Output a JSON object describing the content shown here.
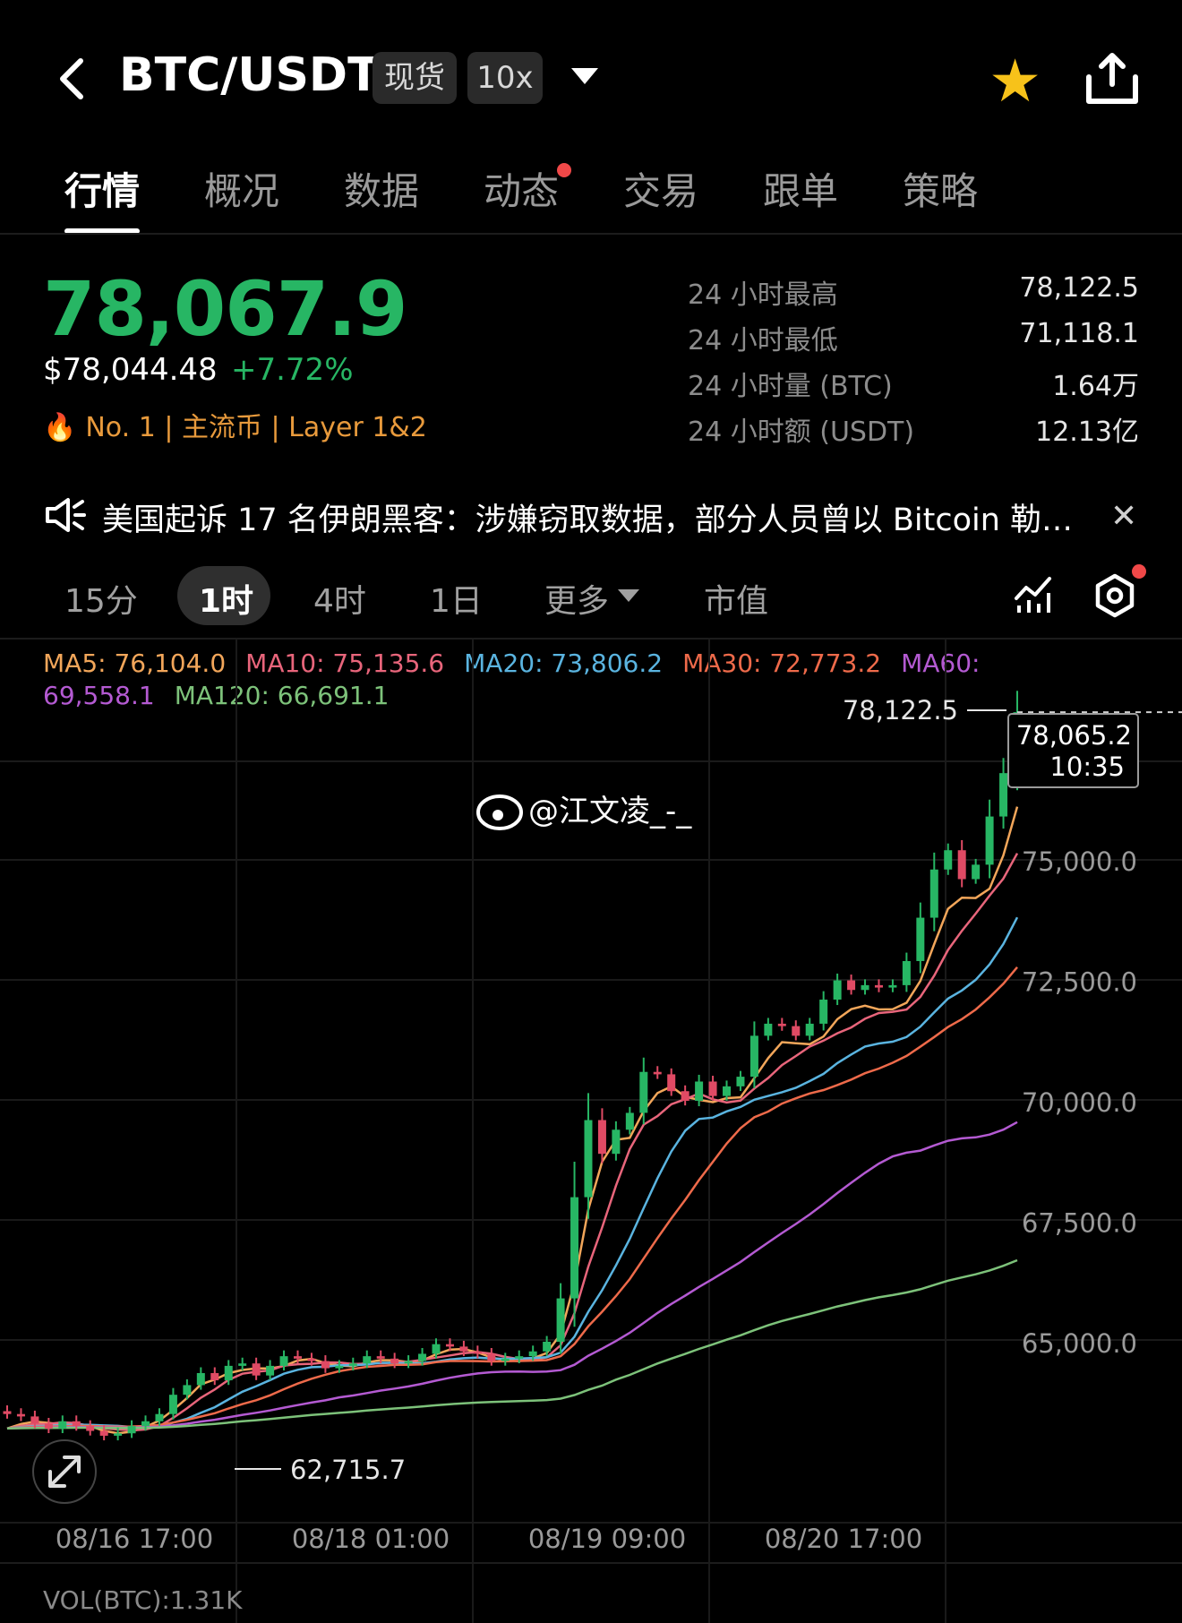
{
  "header": {
    "pair": "BTC/USDT",
    "market_type": "现货",
    "leverage": "10x",
    "favorite_color": "#f7c21a"
  },
  "tabs": [
    {
      "label": "行情",
      "active": true
    },
    {
      "label": "概况"
    },
    {
      "label": "数据"
    },
    {
      "label": "动态",
      "dot": true
    },
    {
      "label": "交易"
    },
    {
      "label": "跟单"
    },
    {
      "label": "策略"
    }
  ],
  "price": {
    "last": "78,067.9",
    "usd": "$78,044.48",
    "change_pct": "+7.72%",
    "tags": "No. 1 | 主流币 | Layer 1&2",
    "up_color": "#27b664"
  },
  "stats": [
    {
      "label": "24 小时最高",
      "value": "78,122.5"
    },
    {
      "label": "24 小时最低",
      "value": "71,118.1"
    },
    {
      "label": "24 小时量 (BTC)",
      "value": "1.64万"
    },
    {
      "label": "24 小时额 (USDT)",
      "value": "12.13亿"
    }
  ],
  "news": {
    "text": "美国起诉 17 名伊朗黑客：涉嫌窃取数据，部分人员曾以 Bitcoin 勒…"
  },
  "intervals": {
    "items": [
      "15分",
      "1时",
      "4时",
      "1日",
      "更多",
      "市值"
    ],
    "active": "1时"
  },
  "ma": {
    "line1": [
      {
        "text": "MA5: 76,104.0",
        "color": "#f2a65a"
      },
      {
        "text": "MA10: 75,135.6",
        "color": "#e8657b"
      },
      {
        "text": "MA20: 73,806.2",
        "color": "#5ab4e0"
      },
      {
        "text": "MA30: 72,773.2",
        "color": "#ee6a4a"
      },
      {
        "text": "MA60:",
        "color": "#b45ad2"
      }
    ],
    "line2": [
      {
        "text": "69,558.1",
        "color": "#b45ad2"
      },
      {
        "text": "MA120: 66,691.1",
        "color": "#7dc27a"
      }
    ]
  },
  "chart_data": {
    "type": "candlestick",
    "y_axis_ticks": [
      75000.0,
      72500.0,
      70000.0,
      67500.0,
      65000.0
    ],
    "y_axis_tick_labels": [
      "75,000.0",
      "72,500.0",
      "70,000.0",
      "67,500.0",
      "65,000.0"
    ],
    "x_axis_tick_labels": [
      "08/16 17:00",
      "08/18 01:00",
      "08/19 09:00",
      "08/20 17:00"
    ],
    "high_label": "78,122.5",
    "low_label": "62,715.7",
    "current_price_label": "78,065.2",
    "current_time_label": "10:35",
    "watermark": "@江文凌_-_",
    "series_close": [
      63500,
      63450,
      63300,
      63200,
      63350,
      63250,
      63150,
      63050,
      63100,
      63250,
      63350,
      63500,
      63900,
      64100,
      64350,
      64200,
      64500,
      64550,
      64300,
      64500,
      64700,
      64650,
      64600,
      64450,
      64500,
      64550,
      64700,
      64650,
      64550,
      64600,
      64750,
      64950,
      64900,
      64800,
      64750,
      64600,
      64650,
      64700,
      64800,
      65000,
      65900,
      68000,
      69600,
      68900,
      69400,
      69750,
      70600,
      70550,
      70200,
      70000,
      70400,
      70100,
      70300,
      70500,
      71350,
      71600,
      71550,
      71350,
      71600,
      72100,
      72500,
      72300,
      72400,
      72350,
      72400,
      72900,
      73800,
      74800,
      75200,
      74600,
      74900,
      75900,
      76800,
      78065
    ],
    "ma_last": {
      "MA5": 76104.0,
      "MA10": 75135.6,
      "MA20": 73806.2,
      "MA30": 72773.2,
      "MA60": 69558.1,
      "MA120": 66691.1
    }
  },
  "footer": {
    "vol": "VOL(BTC):1.31K"
  }
}
